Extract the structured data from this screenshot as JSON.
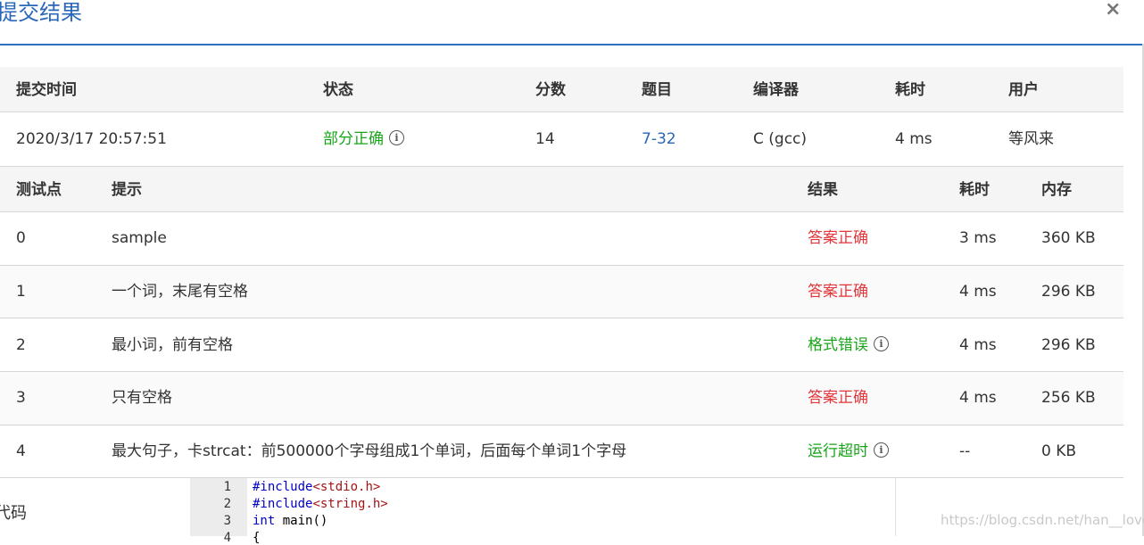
{
  "modal": {
    "title": "提交结果",
    "close_label": "×"
  },
  "summary": {
    "headers": {
      "time": "提交时间",
      "status": "状态",
      "score": "分数",
      "problem": "题目",
      "compiler": "编译器",
      "elapsed": "耗时",
      "user": "用户"
    },
    "row": {
      "time": "2020/3/17 20:57:51",
      "status": "部分正确",
      "score": "14",
      "problem": "7-32",
      "compiler": "C (gcc)",
      "elapsed": "4 ms",
      "user": "等风来"
    }
  },
  "cases": {
    "headers": {
      "id": "测试点",
      "hint": "提示",
      "result": "结果",
      "elapsed": "耗时",
      "memory": "内存"
    },
    "rows": [
      {
        "id": "0",
        "hint": "sample",
        "result": "答案正确",
        "elapsed": "3 ms",
        "memory": "360 KB"
      },
      {
        "id": "1",
        "hint": "一个词，末尾有空格",
        "result": "答案正确",
        "elapsed": "4 ms",
        "memory": "296 KB"
      },
      {
        "id": "2",
        "hint": "最小词，前有空格",
        "result": "格式错误",
        "elapsed": "4 ms",
        "memory": "296 KB"
      },
      {
        "id": "3",
        "hint": "只有空格",
        "result": "答案正确",
        "elapsed": "4 ms",
        "memory": "256 KB"
      },
      {
        "id": "4",
        "hint": "最大句子，卡strcat：前500000个字母组成1个单词，后面每个单词1个字母",
        "result": "运行超时",
        "elapsed": "--",
        "memory": "0 KB"
      }
    ]
  },
  "code": {
    "label": "代码",
    "line_numbers": [
      "1",
      "2",
      "3",
      "4"
    ],
    "lines": [
      {
        "directive": "#include",
        "header": "<stdio.h>"
      },
      {
        "directive": "#include",
        "header": "<string.h>"
      },
      {
        "keyword": "int",
        "rest": " main()"
      },
      {
        "rest": "{"
      }
    ]
  },
  "watermark": "https://blog.csdn.net/han__love",
  "colors": {
    "accent": "#2a67b8",
    "correct": "#e2363b",
    "warning": "#19a519"
  },
  "icons": {
    "info": "info-circle-icon",
    "close": "close-icon"
  }
}
